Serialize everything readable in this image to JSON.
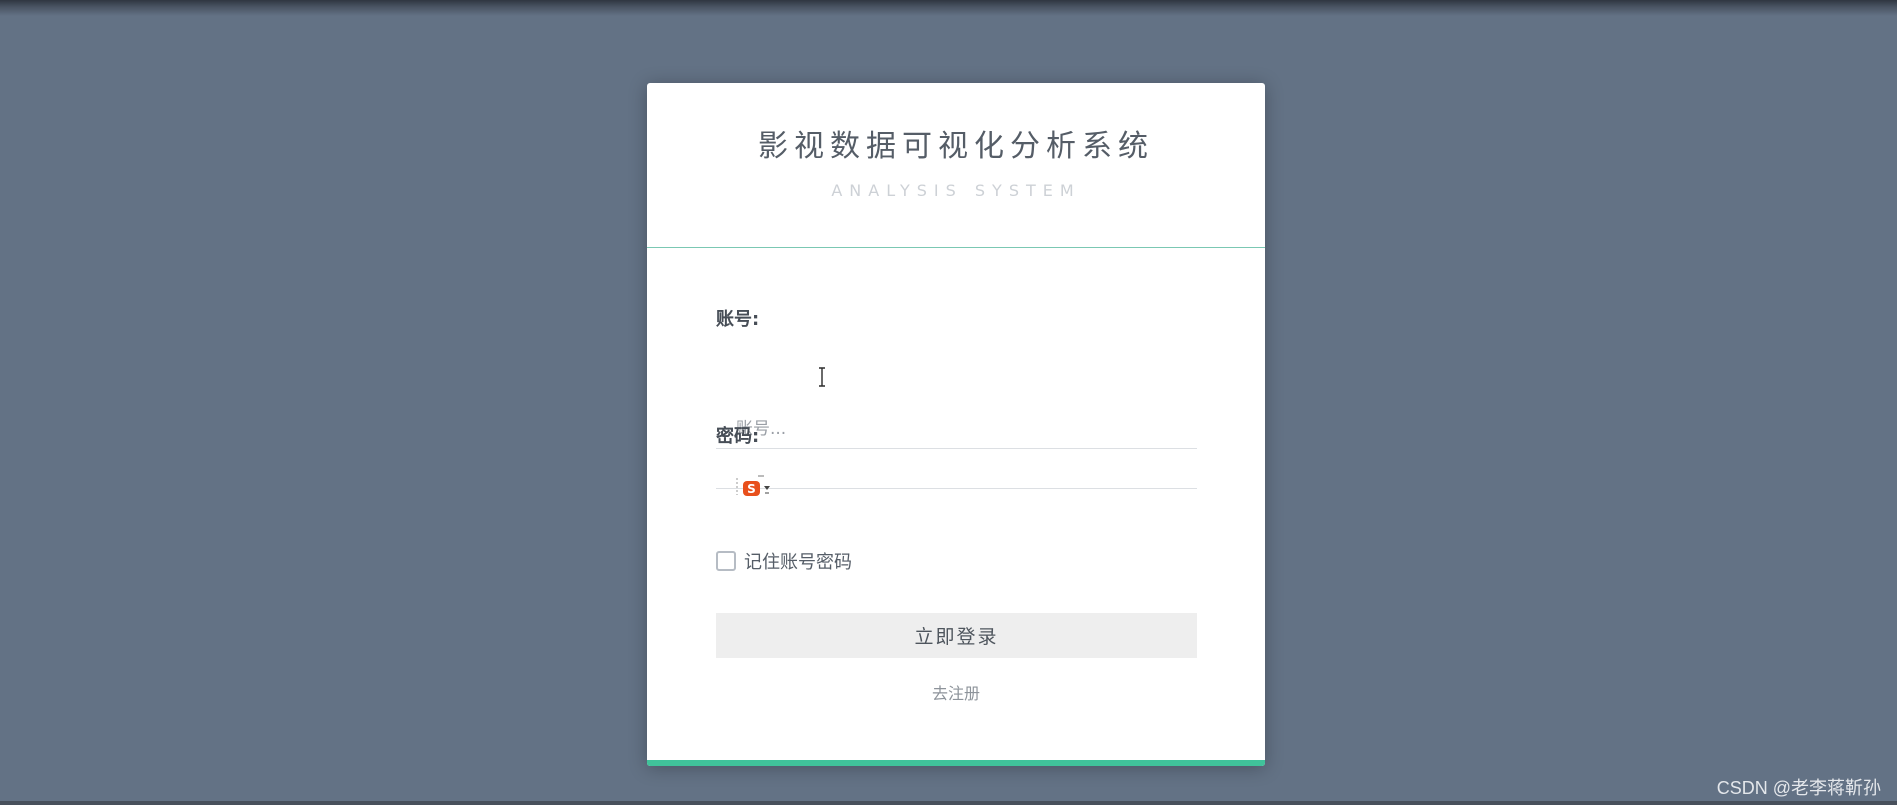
{
  "header": {
    "title": "影视数据可视化分析系统",
    "subtitle": "ANALYSIS SYSTEM"
  },
  "form": {
    "account_label": "账号:",
    "account_placeholder": "账号...",
    "account_value": "",
    "password_label": "密码:",
    "password_value": "",
    "remember_label": "记住账号密码",
    "remember_checked": false,
    "login_button": "立即登录",
    "register_link": "去注册"
  },
  "ime": {
    "icon": "sogou-input-method-icon",
    "glyph": "S"
  },
  "watermark": "CSDN @老李蒋靳孙",
  "colors": {
    "background": "#637285",
    "accent": "#40c29a",
    "divider": "#7bc8b3",
    "title_text": "#555d67",
    "button_bg": "#eeeeee"
  }
}
